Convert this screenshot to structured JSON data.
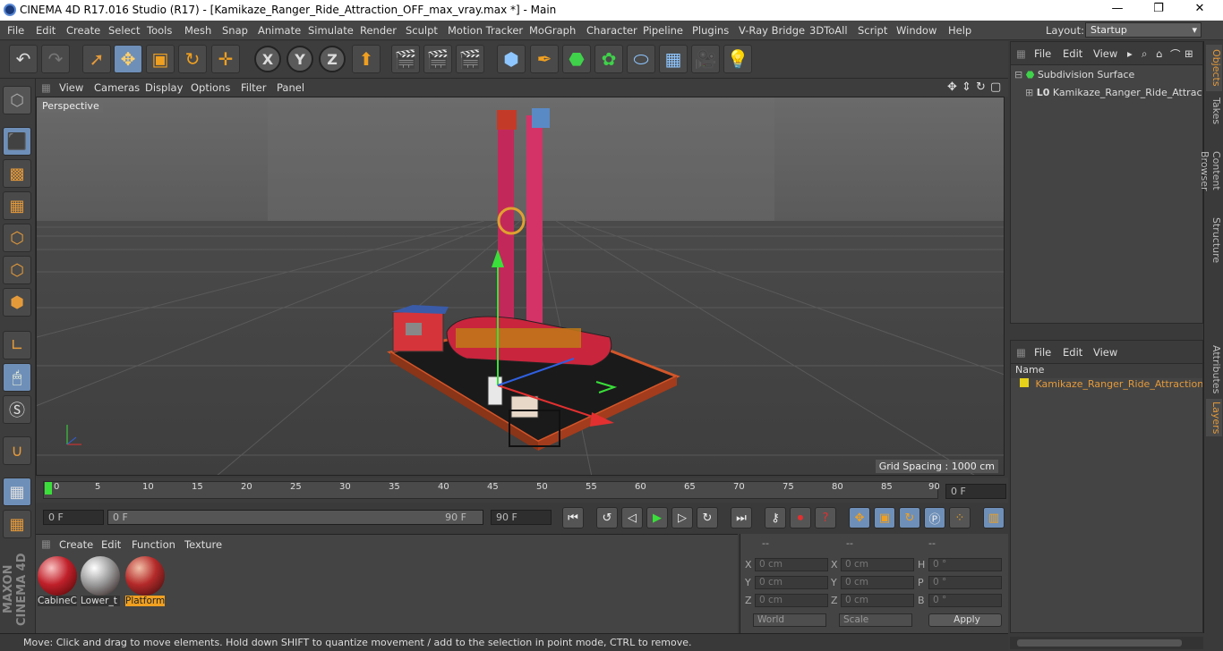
{
  "window": {
    "title": "CINEMA 4D R17.016 Studio (R17) - [Kamikaze_Ranger_Ride_Attraction_OFF_max_vray.max *] - Main",
    "min": "—",
    "max": "❐",
    "close": "✕"
  },
  "menu": [
    "File",
    "Edit",
    "Create",
    "Select",
    "Tools",
    "Mesh",
    "Snap",
    "Animate",
    "Simulate",
    "Render",
    "Sculpt",
    "Motion Tracker",
    "MoGraph",
    "Character",
    "Pipeline",
    "Plugins",
    "V-Ray Bridge",
    "3DToAll",
    "Script",
    "Window",
    "Help"
  ],
  "layout": {
    "label": "Layout:",
    "value": "Startup"
  },
  "viewport": {
    "menu": [
      "View",
      "Cameras",
      "Display",
      "Options",
      "Filter",
      "Panel"
    ],
    "label": "Perspective",
    "grid_spacing": "Grid Spacing : 1000 cm"
  },
  "timeline": {
    "ticks": [
      "0",
      "5",
      "10",
      "15",
      "20",
      "25",
      "30",
      "35",
      "40",
      "45",
      "50",
      "55",
      "60",
      "65",
      "70",
      "75",
      "80",
      "85",
      "90"
    ],
    "current": "0 F"
  },
  "playbar": {
    "start": "0 F",
    "slider_start": "0 F",
    "slider_end": "90 F",
    "end": "90 F"
  },
  "materials": {
    "menu": [
      "Create",
      "Edit",
      "Function",
      "Texture"
    ],
    "items": [
      {
        "label": "CabineC",
        "selected": false
      },
      {
        "label": "Lower_t",
        "selected": false
      },
      {
        "label": "Platform",
        "selected": true
      }
    ]
  },
  "coords": {
    "headers": [
      "--",
      "--",
      "--"
    ],
    "rows": [
      {
        "a": "X",
        "av": "0 cm",
        "b": "X",
        "bv": "0 cm",
        "c": "H",
        "cv": "0 °"
      },
      {
        "a": "Y",
        "av": "0 cm",
        "b": "Y",
        "bv": "0 cm",
        "c": "P",
        "cv": "0 °"
      },
      {
        "a": "Z",
        "av": "0 cm",
        "b": "Z",
        "bv": "0 cm",
        "c": "B",
        "cv": "0 °"
      }
    ],
    "world": "World",
    "scale": "Scale",
    "apply": "Apply"
  },
  "status": "Move: Click and drag to move elements. Hold down SHIFT to quantize movement / add to the selection in point mode, CTRL to remove.",
  "objects": {
    "menu": [
      "File",
      "Edit",
      "View"
    ],
    "items": [
      "Subdivision Surface",
      "Kamikaze_Ranger_Ride_Attractio"
    ]
  },
  "layers": {
    "menu": [
      "File",
      "Edit",
      "View"
    ],
    "column": "Name",
    "items": [
      "Kamikaze_Ranger_Ride_Attraction"
    ]
  },
  "sidetabs": [
    "Objects",
    "Takes",
    "Content Browser",
    "Structure",
    "Attributes",
    "Layers"
  ],
  "brand": "MAXON CINEMA 4D",
  "colors": {
    "accent": "#e59a3a",
    "selection": "#6e8fb8",
    "layer": "#e6d21a"
  }
}
